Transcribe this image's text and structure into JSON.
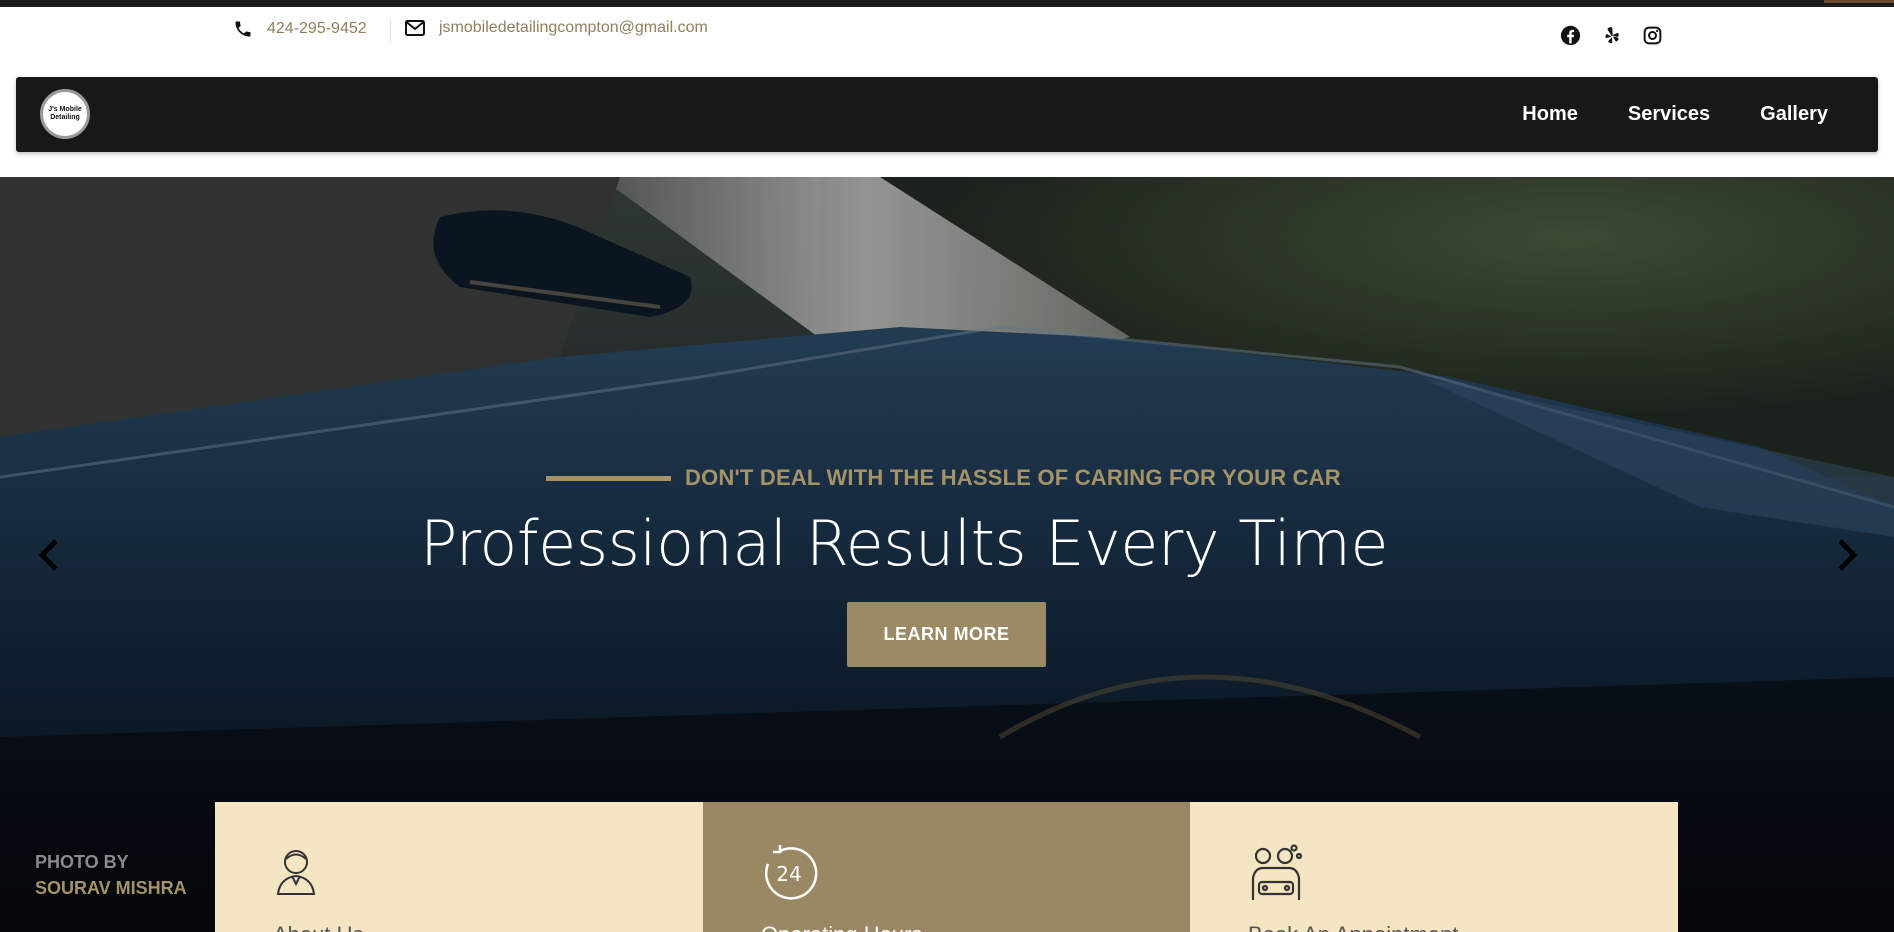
{
  "contact": {
    "phone": "424-295-9452",
    "email": "jsmobiledetailingcompton@gmail.com",
    "phone_icon": "phone-icon",
    "email_icon": "envelope-icon"
  },
  "socials": [
    "facebook-icon",
    "yelp-icon",
    "instagram-icon"
  ],
  "brand": {
    "line1": "J's Mobile",
    "line2": "Detailing"
  },
  "nav": {
    "items": [
      "Home",
      "Services",
      "Gallery"
    ]
  },
  "hero": {
    "tagline": "DON'T DEAL WITH THE HASSLE OF CARING FOR YOUR CAR",
    "headline": "Professional Results Every Time",
    "cta": "LEARN MORE",
    "prev_icon": "chevron-left-icon",
    "next_icon": "chevron-right-icon"
  },
  "credit": {
    "line1": "PHOTO BY",
    "line2": "SOURAV MISHRA"
  },
  "cards": [
    {
      "title": "About Us",
      "icon": "person-icon"
    },
    {
      "title": "Operating Hours",
      "icon": "24-hour-icon"
    },
    {
      "title": "Book An Appointment",
      "icon": "car-wash-icon"
    }
  ],
  "colors": {
    "accent": "#a59367",
    "navbar": "#181818",
    "card_light": "#f4e6c2",
    "card_dark": "#998863"
  }
}
